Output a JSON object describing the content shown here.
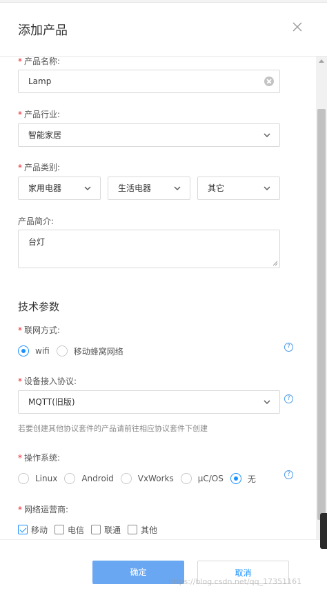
{
  "dialog": {
    "title": "添加产品",
    "close_icon": "close-icon"
  },
  "form": {
    "product_name": {
      "label": "产品名称:",
      "value": "Lamp",
      "required": true
    },
    "industry": {
      "label": "产品行业:",
      "value": "智能家居",
      "required": true
    },
    "category": {
      "label": "产品类别:",
      "required": true,
      "level1": "家用电器",
      "level2": "生活电器",
      "level3": "其它"
    },
    "description": {
      "label": "产品简介:",
      "value": "台灯"
    },
    "tech_section_title": "技术参数",
    "network": {
      "label": "联网方式:",
      "required": true,
      "options": [
        "wifi",
        "移动蜂窝网络"
      ],
      "selected": "wifi"
    },
    "protocol": {
      "label": "设备接入协议:",
      "required": true,
      "value": "MQTT(旧版)",
      "hint": "若要创建其他协议套件的产品请前往相应协议套件下创建"
    },
    "os": {
      "label": "操作系统:",
      "required": true,
      "options": [
        "Linux",
        "Android",
        "VxWorks",
        "μC/OS",
        "无"
      ],
      "selected": "无"
    },
    "carrier": {
      "label": "网络运营商:",
      "required": true,
      "options": [
        "移动",
        "电信",
        "联通",
        "其他"
      ],
      "checked": [
        "移动"
      ]
    }
  },
  "footer": {
    "confirm_label": "确定",
    "cancel_label": "取消",
    "watermark": "https://blog.csdn.net/qq_17351161"
  },
  "colors": {
    "accent": "#1890ff",
    "primary_button": "#6aa7f2",
    "required_star": "#f5222d"
  }
}
